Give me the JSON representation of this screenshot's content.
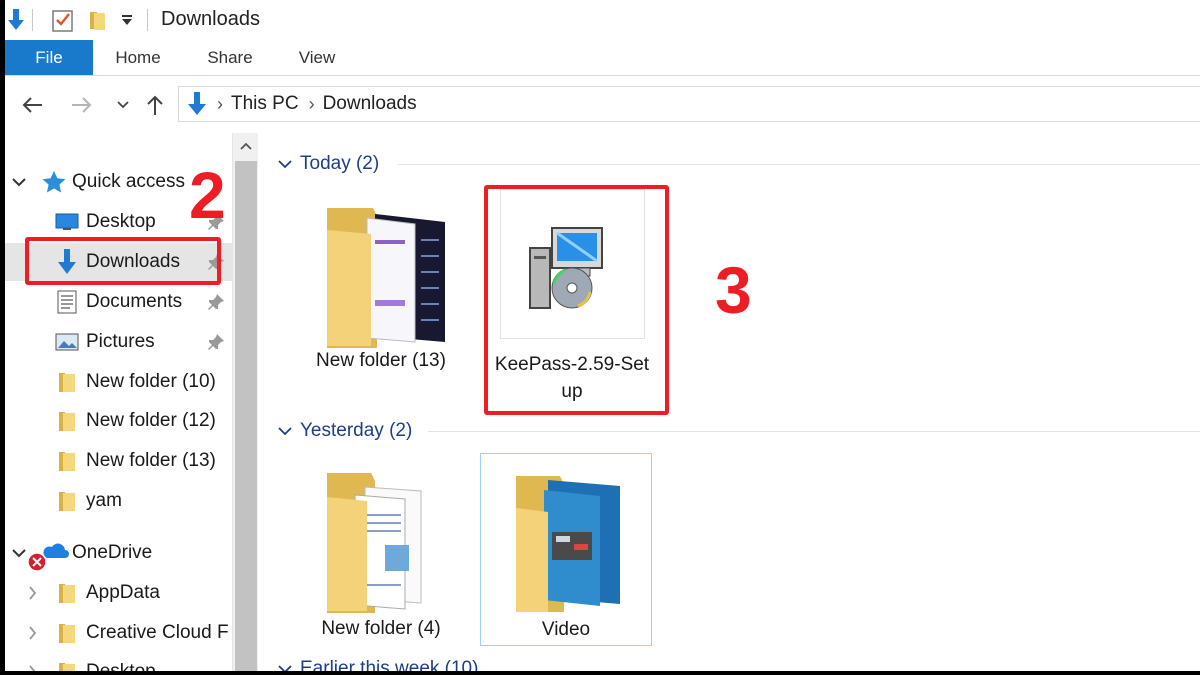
{
  "window": {
    "title": "Downloads"
  },
  "ribbon": {
    "tabs": [
      {
        "label": "File"
      },
      {
        "label": "Home"
      },
      {
        "label": "Share"
      },
      {
        "label": "View"
      }
    ]
  },
  "address": {
    "crumbs": [
      "This PC",
      "Downloads"
    ]
  },
  "navpane": {
    "quick_access": {
      "label": "Quick access"
    },
    "items": [
      {
        "label": "Desktop",
        "icon": "desktop-icon",
        "pinned": true
      },
      {
        "label": "Downloads",
        "icon": "download-arrow-icon",
        "pinned": true,
        "selected": true
      },
      {
        "label": "Documents",
        "icon": "documents-icon",
        "pinned": true
      },
      {
        "label": "Pictures",
        "icon": "pictures-icon",
        "pinned": true
      },
      {
        "label": "New folder (10)",
        "icon": "folder-icon"
      },
      {
        "label": "New folder (12)",
        "icon": "folder-icon"
      },
      {
        "label": "New folder (13)",
        "icon": "folder-icon"
      },
      {
        "label": "yam",
        "icon": "folder-icon"
      }
    ],
    "onedrive": {
      "label": "OneDrive"
    },
    "onedrive_items": [
      {
        "label": "AppData",
        "icon": "folder-icon"
      },
      {
        "label": "Creative Cloud F",
        "icon": "folder-icon"
      },
      {
        "label": "Desktop",
        "icon": "folder-icon"
      }
    ]
  },
  "content": {
    "groups": [
      {
        "header": "Today (2)",
        "items": [
          {
            "name": "New folder (13)",
            "icon": "folder-with-docs-icon"
          },
          {
            "name_line1": "KeePass-2.59-Set",
            "name_line2": "up",
            "icon": "installer-icon"
          }
        ]
      },
      {
        "header": "Yesterday (2)",
        "items": [
          {
            "name": "New folder (4)",
            "icon": "folder-with-docs-icon"
          },
          {
            "name": "Video",
            "icon": "folder-with-images-icon",
            "selected": true
          }
        ]
      },
      {
        "header": "Earlier this week (10)",
        "items": []
      }
    ]
  },
  "annotations": {
    "step2": "2",
    "step3": "3"
  },
  "colors": {
    "accent": "#1979ca",
    "annotation_red": "#ee1c25",
    "group_header": "#1e3e8a"
  }
}
